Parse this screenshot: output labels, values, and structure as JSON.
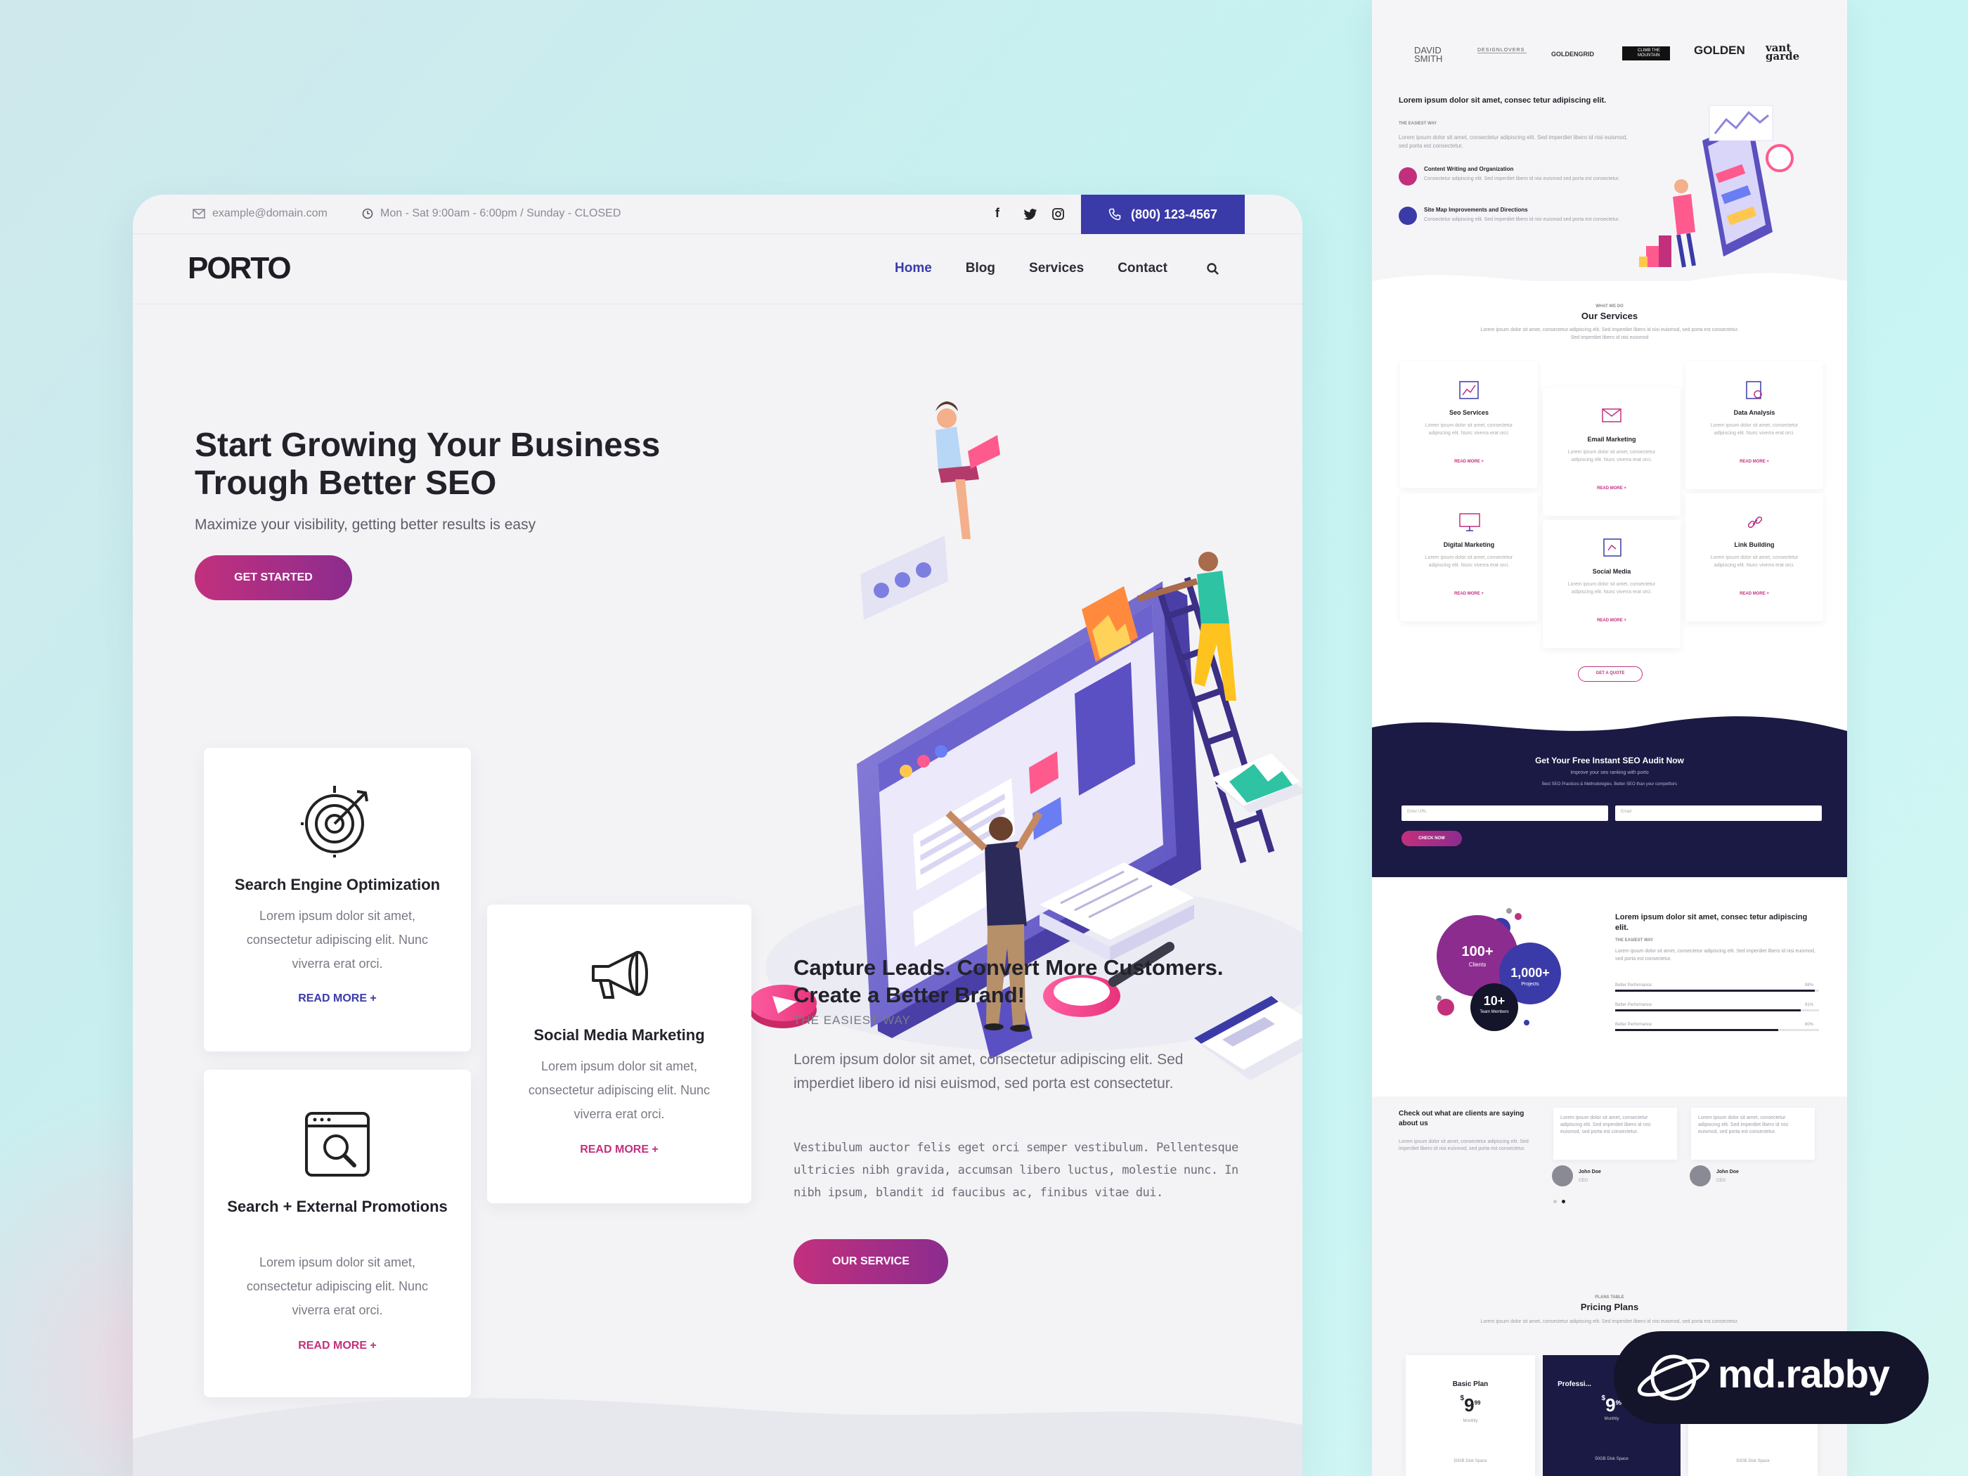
{
  "left": {
    "topbar": {
      "email": "example@domain.com",
      "hours": "Mon - Sat 9:00am - 6:00pm / Sunday - CLOSED",
      "phone": "(800) 123-4567"
    },
    "logo": "PORTO",
    "nav": [
      "Home",
      "Blog",
      "Services",
      "Contact"
    ],
    "hero": {
      "title_line1": "Start Growing Your Business",
      "title_line2": "Trough Better SEO",
      "subtitle": "Maximize your visibility, getting better results is easy",
      "cta": "GET STARTED"
    },
    "cards": [
      {
        "title": "Search Engine Optimization",
        "desc": "Lorem ipsum dolor sit amet, consectetur adipiscing elit. Nunc viverra erat orci.",
        "link": "READ MORE +",
        "icon": "target-icon"
      },
      {
        "title": "Social Media Marketing",
        "desc": "Lorem ipsum dolor sit amet, consectetur adipiscing elit. Nunc viverra erat orci.",
        "link": "READ MORE +",
        "icon": "megaphone-icon"
      },
      {
        "title": "Search + External Promotions",
        "desc": "Lorem ipsum dolor sit amet, consectetur adipiscing elit. Nunc viverra erat orci.",
        "link": "READ MORE +",
        "icon": "browser-search-icon"
      }
    ],
    "section": {
      "title_line1": "Capture Leads. Convert More Customers.",
      "title_line2": "Create a Better Brand!",
      "kicker": "THE EASIEST WAY",
      "p1": "Lorem ipsum dolor sit amet, consectetur adipiscing elit. Sed imperdiet libero id nisi euismod, sed porta est consectetur.",
      "p2": "Vestibulum auctor felis eget orci semper vestibulum. Pellentesque ultricies nibh gravida, accumsan libero luctus, molestie nunc. In nibh ipsum, blandit id faucibus ac, finibus vitae dui.",
      "cta": "OUR SERVICE"
    }
  },
  "right": {
    "brands": [
      "DAVID SMITH",
      "DESIGNLOVERS",
      "GOLDENGRID",
      "CLIMB THE MOUNTAIN",
      "GOLDEN",
      "vant garde"
    ],
    "intro": {
      "title": "Lorem ipsum dolor sit amet, consec tetur adipiscing elit.",
      "kicker": "THE EASIEST WAY",
      "text": "Lorem ipsum dolor sit amet, consectetur adipiscing elit. Sed imperdiet libero id nisi euismod, sed porta est consectetur.",
      "features": [
        {
          "title": "Content Writing and Organization",
          "text": "Consectetur adipiscing elit. Sed imperdiet libero id nisi euismod sed porta est consectetur."
        },
        {
          "title": "Site Map Improvements and Directions",
          "text": "Consectetur adipiscing elit. Sed imperdiet libero id nisi euismod sed porta est consectetur."
        }
      ]
    },
    "services": {
      "kicker": "WHAT WE DO",
      "title": "Our Services",
      "text": "Lorem ipsum dolor sit amet, consectetur adipiscing elit. Sed imperdiet libero id nisi euismod, sed porta est consectetur. Sed imperdiet libero id nisi euismod",
      "items": [
        {
          "title": "Seo Services",
          "desc": "Lorem ipsum dolor sit amet, consectetur adipiscing elit. Nunc viverra erat orci.",
          "link": "READ MORE +"
        },
        {
          "title": "Email Marketing",
          "desc": "Lorem ipsum dolor sit amet, consectetur adipiscing elit. Nunc viverra erat orci.",
          "link": "READ MORE +"
        },
        {
          "title": "Data Analysis",
          "desc": "Lorem ipsum dolor sit amet, consectetur adipiscing elit. Nunc viverra erat orci.",
          "link": "READ MORE +"
        },
        {
          "title": "Digital Marketing",
          "desc": "Lorem ipsum dolor sit amet, consectetur adipiscing elit. Nunc viverra erat orci.",
          "link": "READ MORE +"
        },
        {
          "title": "Social Media",
          "desc": "Lorem ipsum dolor sit amet, consectetur adipiscing elit. Nunc viverra erat orci.",
          "link": "READ MORE +"
        },
        {
          "title": "Link Building",
          "desc": "Lorem ipsum dolor sit amet, consectetur adipiscing elit. Nunc viverra erat orci.",
          "link": "READ MORE +"
        }
      ],
      "quote_button": "GET A QUOTE"
    },
    "audit": {
      "title": "Get Your Free Instant SEO Audit Now",
      "sub1": "Improve your seo ranking with porto",
      "sub2": "Best SEO Practices & Methodologies. Better SEO than your competitors",
      "url_placeholder": "Enter URL",
      "email_placeholder": "Email",
      "button": "CHECK NOW"
    },
    "stats": {
      "clients": {
        "value": "100+",
        "label": "Clients"
      },
      "projects": {
        "value": "1,000+",
        "label": "Projects"
      },
      "team": {
        "value": "10+",
        "label": "Team Members"
      },
      "title": "Lorem ipsum dolor sit amet, consec tetur adipiscing elit.",
      "kicker": "THE EASIEST WAY",
      "text": "Lorem ipsum dolor sit amet, consectetur adipiscing elit. Sed imperdiet libero id nisi euismod, sed porta est consectetur.",
      "bars": [
        {
          "label": "Better Performance",
          "pct": "98%",
          "value": 0.98
        },
        {
          "label": "Better Performance",
          "pct": "91%",
          "value": 0.91
        },
        {
          "label": "Better Performance",
          "pct": "80%",
          "value": 0.8
        }
      ]
    },
    "testimonials": {
      "title": "Check out what are clients are saying about us",
      "text": "Lorem ipsum dolor sit amet, consectetur adipiscing elit. Sed imperdiet libero id nisi euismod, sed porta est consectetur.",
      "items": [
        {
          "quote": "Lorem ipsum dolor sit amet, consectetur adipiscing elit. Sed imperdiet libero id nisi euismod, sed porta est consectetur.",
          "name": "John Doe",
          "role": "CEO"
        },
        {
          "quote": "Lorem ipsum dolor sit amet, consectetur adipiscing elit. Sed imperdiet libero id nisi euismod, sed porta est consectetur.",
          "name": "John Doe",
          "role": "CEO"
        }
      ]
    },
    "pricing": {
      "kicker": "PLANS TABLE",
      "title": "Pricing Plans",
      "text": "Lorem ipsum dolor sit amet, consectetur adipiscing elit. Sed imperdiet libero id nisi euismod, sed porta est consectetur.",
      "plans": [
        {
          "name": "Basic Plan",
          "price": "9",
          "cents": "99",
          "period": "Monthly",
          "note": "50GB Disk Space"
        },
        {
          "name": "Professi...",
          "price": "9",
          "cents": "99",
          "period": "Monthly",
          "note": "50GB Disk Space"
        },
        {
          "name": "",
          "price": "9",
          "cents": "99",
          "period": "Monthly",
          "note": "50GB Disk Space"
        }
      ]
    }
  },
  "badge": "md.rabby",
  "colors": {
    "primary": "#3a3ba8",
    "accent": "#c2307d",
    "dark": "#1b1a44"
  }
}
